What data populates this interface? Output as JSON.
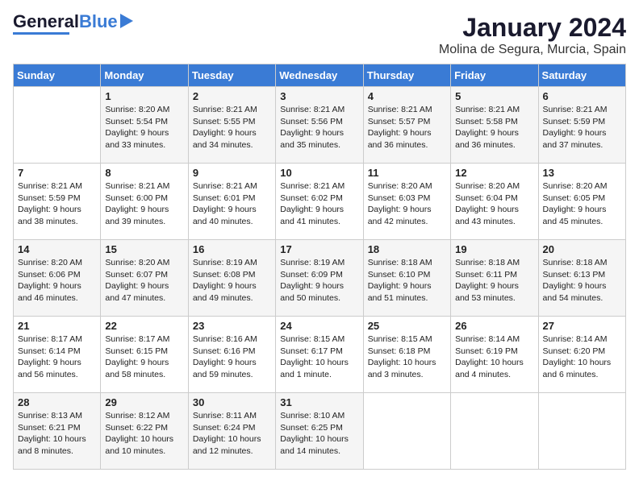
{
  "header": {
    "logo_general": "General",
    "logo_blue": "Blue",
    "month": "January 2024",
    "location": "Molina de Segura, Murcia, Spain"
  },
  "weekdays": [
    "Sunday",
    "Monday",
    "Tuesday",
    "Wednesday",
    "Thursday",
    "Friday",
    "Saturday"
  ],
  "weeks": [
    [
      {
        "day": "",
        "sunrise": "",
        "sunset": "",
        "daylight": ""
      },
      {
        "day": "1",
        "sunrise": "8:20 AM",
        "sunset": "5:54 PM",
        "daylight": "9 hours and 33 minutes."
      },
      {
        "day": "2",
        "sunrise": "8:21 AM",
        "sunset": "5:55 PM",
        "daylight": "9 hours and 34 minutes."
      },
      {
        "day": "3",
        "sunrise": "8:21 AM",
        "sunset": "5:56 PM",
        "daylight": "9 hours and 35 minutes."
      },
      {
        "day": "4",
        "sunrise": "8:21 AM",
        "sunset": "5:57 PM",
        "daylight": "9 hours and 36 minutes."
      },
      {
        "day": "5",
        "sunrise": "8:21 AM",
        "sunset": "5:58 PM",
        "daylight": "9 hours and 36 minutes."
      },
      {
        "day": "6",
        "sunrise": "8:21 AM",
        "sunset": "5:59 PM",
        "daylight": "9 hours and 37 minutes."
      }
    ],
    [
      {
        "day": "7",
        "sunrise": "8:21 AM",
        "sunset": "5:59 PM",
        "daylight": "9 hours and 38 minutes."
      },
      {
        "day": "8",
        "sunrise": "8:21 AM",
        "sunset": "6:00 PM",
        "daylight": "9 hours and 39 minutes."
      },
      {
        "day": "9",
        "sunrise": "8:21 AM",
        "sunset": "6:01 PM",
        "daylight": "9 hours and 40 minutes."
      },
      {
        "day": "10",
        "sunrise": "8:21 AM",
        "sunset": "6:02 PM",
        "daylight": "9 hours and 41 minutes."
      },
      {
        "day": "11",
        "sunrise": "8:20 AM",
        "sunset": "6:03 PM",
        "daylight": "9 hours and 42 minutes."
      },
      {
        "day": "12",
        "sunrise": "8:20 AM",
        "sunset": "6:04 PM",
        "daylight": "9 hours and 43 minutes."
      },
      {
        "day": "13",
        "sunrise": "8:20 AM",
        "sunset": "6:05 PM",
        "daylight": "9 hours and 45 minutes."
      }
    ],
    [
      {
        "day": "14",
        "sunrise": "8:20 AM",
        "sunset": "6:06 PM",
        "daylight": "9 hours and 46 minutes."
      },
      {
        "day": "15",
        "sunrise": "8:20 AM",
        "sunset": "6:07 PM",
        "daylight": "9 hours and 47 minutes."
      },
      {
        "day": "16",
        "sunrise": "8:19 AM",
        "sunset": "6:08 PM",
        "daylight": "9 hours and 49 minutes."
      },
      {
        "day": "17",
        "sunrise": "8:19 AM",
        "sunset": "6:09 PM",
        "daylight": "9 hours and 50 minutes."
      },
      {
        "day": "18",
        "sunrise": "8:18 AM",
        "sunset": "6:10 PM",
        "daylight": "9 hours and 51 minutes."
      },
      {
        "day": "19",
        "sunrise": "8:18 AM",
        "sunset": "6:11 PM",
        "daylight": "9 hours and 53 minutes."
      },
      {
        "day": "20",
        "sunrise": "8:18 AM",
        "sunset": "6:13 PM",
        "daylight": "9 hours and 54 minutes."
      }
    ],
    [
      {
        "day": "21",
        "sunrise": "8:17 AM",
        "sunset": "6:14 PM",
        "daylight": "9 hours and 56 minutes."
      },
      {
        "day": "22",
        "sunrise": "8:17 AM",
        "sunset": "6:15 PM",
        "daylight": "9 hours and 58 minutes."
      },
      {
        "day": "23",
        "sunrise": "8:16 AM",
        "sunset": "6:16 PM",
        "daylight": "9 hours and 59 minutes."
      },
      {
        "day": "24",
        "sunrise": "8:15 AM",
        "sunset": "6:17 PM",
        "daylight": "10 hours and 1 minute."
      },
      {
        "day": "25",
        "sunrise": "8:15 AM",
        "sunset": "6:18 PM",
        "daylight": "10 hours and 3 minutes."
      },
      {
        "day": "26",
        "sunrise": "8:14 AM",
        "sunset": "6:19 PM",
        "daylight": "10 hours and 4 minutes."
      },
      {
        "day": "27",
        "sunrise": "8:14 AM",
        "sunset": "6:20 PM",
        "daylight": "10 hours and 6 minutes."
      }
    ],
    [
      {
        "day": "28",
        "sunrise": "8:13 AM",
        "sunset": "6:21 PM",
        "daylight": "10 hours and 8 minutes."
      },
      {
        "day": "29",
        "sunrise": "8:12 AM",
        "sunset": "6:22 PM",
        "daylight": "10 hours and 10 minutes."
      },
      {
        "day": "30",
        "sunrise": "8:11 AM",
        "sunset": "6:24 PM",
        "daylight": "10 hours and 12 minutes."
      },
      {
        "day": "31",
        "sunrise": "8:10 AM",
        "sunset": "6:25 PM",
        "daylight": "10 hours and 14 minutes."
      },
      {
        "day": "",
        "sunrise": "",
        "sunset": "",
        "daylight": ""
      },
      {
        "day": "",
        "sunrise": "",
        "sunset": "",
        "daylight": ""
      },
      {
        "day": "",
        "sunrise": "",
        "sunset": "",
        "daylight": ""
      }
    ]
  ]
}
